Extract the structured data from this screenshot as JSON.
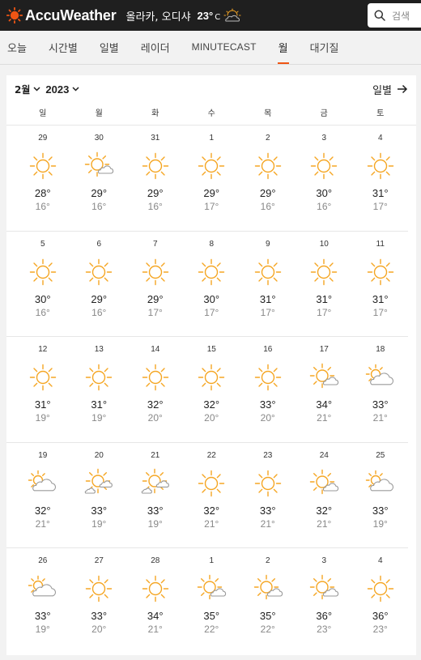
{
  "header": {
    "brand": "AccuWeather",
    "location": "올라카, 오디샤",
    "current_temp": "23°",
    "current_unit": "C",
    "search_placeholder": "검색",
    "brand_color": "#f05514"
  },
  "tabs": [
    {
      "label": "오늘",
      "active": false
    },
    {
      "label": "시간별",
      "active": false
    },
    {
      "label": "일별",
      "active": false
    },
    {
      "label": "레이더",
      "active": false
    },
    {
      "label": "MINUTECAST",
      "active": false
    },
    {
      "label": "월",
      "active": true
    },
    {
      "label": "대기질",
      "active": false
    }
  ],
  "calendar": {
    "month": "2월",
    "year": "2023",
    "daily_link": "일별",
    "weekdays": [
      "일",
      "월",
      "화",
      "수",
      "목",
      "금",
      "토"
    ],
    "weeks": [
      [
        {
          "day": "29",
          "hi": "28°",
          "lo": "16°",
          "icon": "sunny"
        },
        {
          "day": "30",
          "hi": "29°",
          "lo": "16°",
          "icon": "mostly-sunny"
        },
        {
          "day": "31",
          "hi": "29°",
          "lo": "16°",
          "icon": "sunny"
        },
        {
          "day": "1",
          "hi": "29°",
          "lo": "17°",
          "icon": "sunny"
        },
        {
          "day": "2",
          "hi": "29°",
          "lo": "16°",
          "icon": "sunny"
        },
        {
          "day": "3",
          "hi": "30°",
          "lo": "16°",
          "icon": "sunny"
        },
        {
          "day": "4",
          "hi": "31°",
          "lo": "17°",
          "icon": "sunny"
        }
      ],
      [
        {
          "day": "5",
          "hi": "30°",
          "lo": "16°",
          "icon": "sunny"
        },
        {
          "day": "6",
          "hi": "29°",
          "lo": "16°",
          "icon": "sunny"
        },
        {
          "day": "7",
          "hi": "29°",
          "lo": "17°",
          "icon": "sunny"
        },
        {
          "day": "8",
          "hi": "30°",
          "lo": "17°",
          "icon": "sunny"
        },
        {
          "day": "9",
          "hi": "31°",
          "lo": "17°",
          "icon": "sunny"
        },
        {
          "day": "10",
          "hi": "31°",
          "lo": "17°",
          "icon": "sunny"
        },
        {
          "day": "11",
          "hi": "31°",
          "lo": "17°",
          "icon": "sunny"
        }
      ],
      [
        {
          "day": "12",
          "hi": "31°",
          "lo": "19°",
          "icon": "sunny"
        },
        {
          "day": "13",
          "hi": "31°",
          "lo": "19°",
          "icon": "sunny"
        },
        {
          "day": "14",
          "hi": "32°",
          "lo": "20°",
          "icon": "sunny"
        },
        {
          "day": "15",
          "hi": "32°",
          "lo": "20°",
          "icon": "sunny"
        },
        {
          "day": "16",
          "hi": "33°",
          "lo": "20°",
          "icon": "sunny"
        },
        {
          "day": "17",
          "hi": "34°",
          "lo": "21°",
          "icon": "mostly-sunny"
        },
        {
          "day": "18",
          "hi": "33°",
          "lo": "21°",
          "icon": "partly-cloudy"
        }
      ],
      [
        {
          "day": "19",
          "hi": "32°",
          "lo": "21°",
          "icon": "partly-cloudy"
        },
        {
          "day": "20",
          "hi": "33°",
          "lo": "19°",
          "icon": "partly-sunny-clouds"
        },
        {
          "day": "21",
          "hi": "33°",
          "lo": "19°",
          "icon": "partly-sunny-clouds"
        },
        {
          "day": "22",
          "hi": "32°",
          "lo": "21°",
          "icon": "sunny"
        },
        {
          "day": "23",
          "hi": "33°",
          "lo": "21°",
          "icon": "sunny"
        },
        {
          "day": "24",
          "hi": "32°",
          "lo": "21°",
          "icon": "mostly-sunny"
        },
        {
          "day": "25",
          "hi": "33°",
          "lo": "19°",
          "icon": "partly-cloudy"
        }
      ],
      [
        {
          "day": "26",
          "hi": "33°",
          "lo": "19°",
          "icon": "partly-cloudy"
        },
        {
          "day": "27",
          "hi": "33°",
          "lo": "20°",
          "icon": "sunny"
        },
        {
          "day": "28",
          "hi": "34°",
          "lo": "21°",
          "icon": "sunny"
        },
        {
          "day": "1",
          "hi": "35°",
          "lo": "22°",
          "icon": "mostly-sunny"
        },
        {
          "day": "2",
          "hi": "35°",
          "lo": "22°",
          "icon": "mostly-sunny"
        },
        {
          "day": "3",
          "hi": "36°",
          "lo": "23°",
          "icon": "mostly-sunny"
        },
        {
          "day": "4",
          "hi": "36°",
          "lo": "23°",
          "icon": "sunny"
        }
      ]
    ]
  }
}
